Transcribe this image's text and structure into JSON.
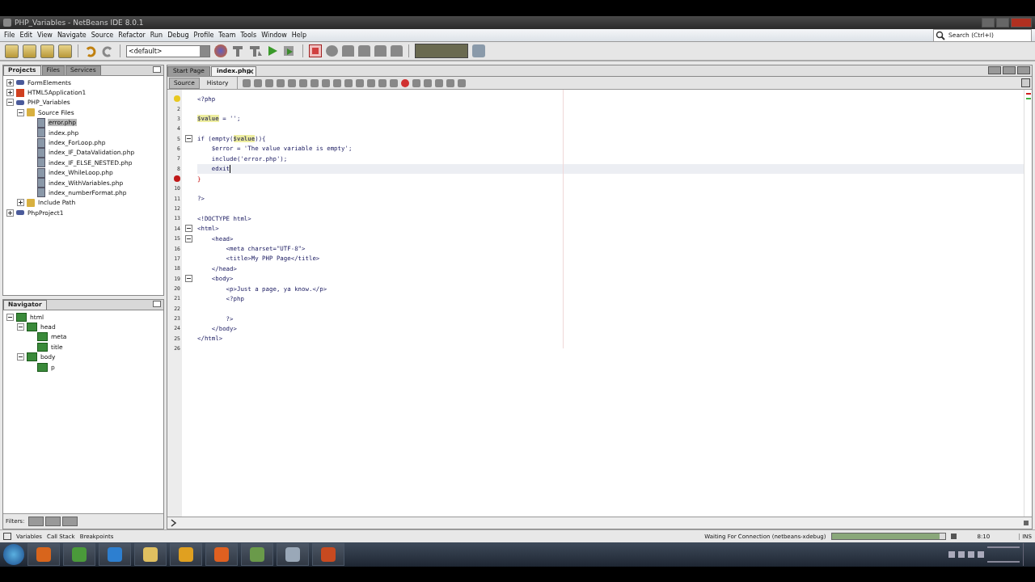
{
  "window": {
    "title": "PHP_Variables - NetBeans IDE 8.0.1"
  },
  "menu": [
    "File",
    "Edit",
    "View",
    "Navigate",
    "Source",
    "Refactor",
    "Run",
    "Debug",
    "Profile",
    "Team",
    "Tools",
    "Window",
    "Help"
  ],
  "search": {
    "placeholder": "Search (Ctrl+I)"
  },
  "toolbar": {
    "config": "<default>"
  },
  "projects_panel": {
    "tabs": [
      {
        "label": "Projects",
        "selected": true
      },
      {
        "label": "Files",
        "selected": false
      },
      {
        "label": "Services",
        "selected": false
      }
    ],
    "tree": [
      {
        "label": "FormElements",
        "kind": "project",
        "expanded": false,
        "selected": false
      },
      {
        "label": "HTML5Application1",
        "kind": "html5",
        "expanded": false,
        "selected": false
      },
      {
        "label": "PHP_Variables",
        "kind": "project",
        "expanded": true,
        "selected": false,
        "children": [
          {
            "label": "Source Files",
            "kind": "folder",
            "expanded": true,
            "selected": false,
            "children": [
              {
                "label": "error.php",
                "kind": "file",
                "selected": true
              },
              {
                "label": "index.php",
                "kind": "file",
                "selected": false
              },
              {
                "label": "index_ForLoop.php",
                "kind": "file",
                "selected": false
              },
              {
                "label": "index_IF_DataValidation.php",
                "kind": "file",
                "selected": false
              },
              {
                "label": "index_IF_ELSE_NESTED.php",
                "kind": "file",
                "selected": false
              },
              {
                "label": "index_WhileLoop.php",
                "kind": "file",
                "selected": false
              },
              {
                "label": "index_WithVariables.php",
                "kind": "file",
                "selected": false
              },
              {
                "label": "index_numberFormat.php",
                "kind": "file",
                "selected": false
              }
            ]
          },
          {
            "label": "Include Path",
            "kind": "folder",
            "expanded": false,
            "selected": false
          }
        ]
      },
      {
        "label": "PhpProject1",
        "kind": "project",
        "expanded": false,
        "selected": false
      }
    ]
  },
  "navigator": {
    "title": "Navigator",
    "tree": [
      {
        "label": "html",
        "expanded": true,
        "children": [
          {
            "label": "head",
            "expanded": true,
            "children": [
              {
                "label": "meta"
              },
              {
                "label": "title"
              }
            ]
          },
          {
            "label": "body",
            "expanded": true,
            "children": [
              {
                "label": "p"
              }
            ]
          }
        ]
      }
    ],
    "filters_label": "Filters:"
  },
  "editor": {
    "tabs": [
      {
        "label": "Start Page",
        "selected": false
      },
      {
        "label": "index.php",
        "selected": true
      }
    ],
    "views": [
      {
        "label": "Source",
        "selected": true
      },
      {
        "label": "History",
        "selected": false
      }
    ],
    "lines": [
      {
        "kind": "hint",
        "text": "<?php"
      },
      {
        "num": "2"
      },
      {
        "num": "3",
        "text": "**$value** = '';"
      },
      {
        "num": "4"
      },
      {
        "num": "5",
        "expanded": true,
        "text": "if (empty(**$value**)){"
      },
      {
        "num": "6",
        "text": "    $error = 'The value variable is empty';"
      },
      {
        "num": "7",
        "text": "    include('error.php');"
      },
      {
        "num": "8",
        "current": true,
        "text": "    edxit"
      },
      {
        "kind": "error",
        "text": "}"
      },
      {
        "num": "10"
      },
      {
        "num": "11",
        "text": "?>"
      },
      {
        "num": "12"
      },
      {
        "num": "13",
        "text": "<!DOCTYPE html>"
      },
      {
        "num": "14",
        "expanded": true,
        "text": "<html>"
      },
      {
        "num": "15",
        "expanded": true,
        "text": "    <head>"
      },
      {
        "num": "16",
        "text": "        <meta charset=\"UTF-8\">"
      },
      {
        "num": "17",
        "text": "        <title>My PHP Page</title>"
      },
      {
        "num": "18",
        "text": "    </head>"
      },
      {
        "num": "19",
        "expanded": true,
        "text": "    <body>"
      },
      {
        "num": "20",
        "text": "        <p>Just a page, ya know.</p>"
      },
      {
        "num": "21",
        "text": "        <?php"
      },
      {
        "num": "22"
      },
      {
        "num": "23",
        "text": "        ?>"
      },
      {
        "num": "24",
        "text": "    </body>"
      },
      {
        "num": "25",
        "text": "</html>"
      },
      {
        "num": "26"
      }
    ]
  },
  "bottom_tabs": [
    "Variables",
    "Call Stack",
    "Breakpoints"
  ],
  "status_bar": {
    "message": "Waiting For Connection (netbeans-xdebug)",
    "level": 0.95,
    "position": "8:10",
    "mode": "INS"
  }
}
